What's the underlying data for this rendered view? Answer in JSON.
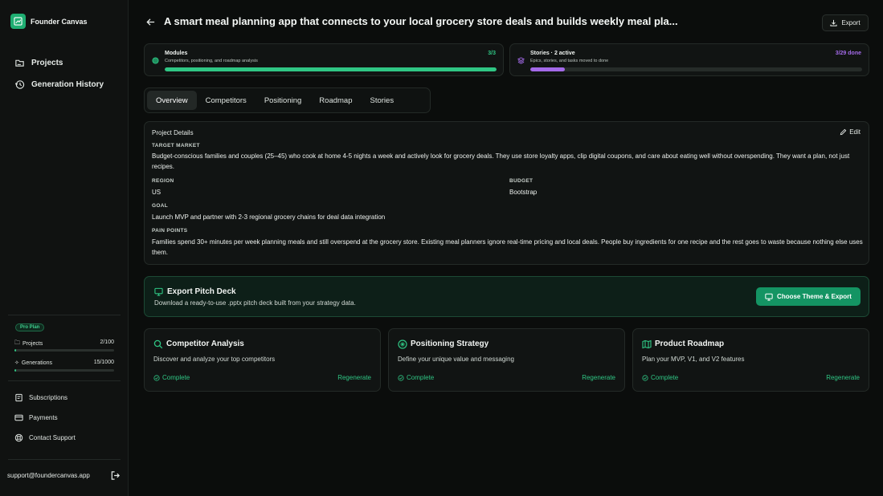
{
  "app": {
    "name": "Founder Canvas"
  },
  "sidebar": {
    "nav": [
      {
        "label": "Projects",
        "icon": "projects-icon"
      },
      {
        "label": "Generation History",
        "icon": "history-icon"
      }
    ],
    "plan_badge": "Pro Plan",
    "usage": [
      {
        "label": "Projects",
        "value": "2/100",
        "progress": 0.02
      },
      {
        "label": "Generations",
        "value": "15/1000",
        "progress": 0.015
      }
    ],
    "links": [
      {
        "label": "Subscriptions",
        "icon": "subscriptions-icon"
      },
      {
        "label": "Payments",
        "icon": "card-icon"
      },
      {
        "label": "Contact Support",
        "icon": "support-icon"
      }
    ],
    "email": "support@foundercanvas.app"
  },
  "header": {
    "title": "A smart meal planning app that connects to your local grocery store deals and builds weekly meal pla...",
    "export_label": "Export"
  },
  "progress": {
    "modules": {
      "title": "Modules",
      "subtitle": "Competitors, positioning, and roadmap analysis",
      "count": "3/3",
      "fraction": 1.0,
      "color": "#2fc684"
    },
    "stories": {
      "title": "Stories · 2 active",
      "subtitle": "Epics, stories, and tasks moved to done",
      "count": "3/29 done",
      "fraction": 0.103,
      "color": "#a36ae8"
    }
  },
  "tabs": [
    "Overview",
    "Competitors",
    "Positioning",
    "Roadmap",
    "Stories"
  ],
  "active_tab": "Overview",
  "details": {
    "header": "Project Details",
    "edit_label": "Edit",
    "target_market_label": "TARGET MARKET",
    "target_market": "Budget-conscious families and couples (25–45) who cook at home 4-5 nights a week and actively look for grocery deals. They use store loyalty apps, clip digital coupons, and care about eating well without overspending. They want a plan, not just recipes.",
    "region_label": "REGION",
    "region": "US",
    "budget_label": "BUDGET",
    "budget": "Bootstrap",
    "goal_label": "GOAL",
    "goal": "Launch MVP and partner with 2-3 regional grocery chains for deal data integration",
    "pain_points_label": "PAIN POINTS",
    "pain_points": "Families spend 30+ minutes per week planning meals and still overspend at the grocery store. Existing meal planners ignore real-time pricing and local deals. People buy ingredients for one recipe and the rest goes to waste because nothing else uses them."
  },
  "pitch_deck": {
    "title": "Export Pitch Deck",
    "subtitle": "Download a ready-to-use .pptx pitch deck built from your strategy data.",
    "button_label": "Choose Theme & Export"
  },
  "modules": [
    {
      "title": "Competitor Analysis",
      "description": "Discover and analyze your top competitors",
      "status": "Complete",
      "action": "Regenerate",
      "icon": "search-icon"
    },
    {
      "title": "Positioning Strategy",
      "description": "Define your unique value and messaging",
      "status": "Complete",
      "action": "Regenerate",
      "icon": "target-icon"
    },
    {
      "title": "Product Roadmap",
      "description": "Plan your MVP, V1, and V2 features",
      "status": "Complete",
      "action": "Regenerate",
      "icon": "map-icon"
    }
  ],
  "colors": {
    "accent": "#2fc684",
    "background": "#0b0d0c",
    "stories_accent": "#a36ae8"
  }
}
